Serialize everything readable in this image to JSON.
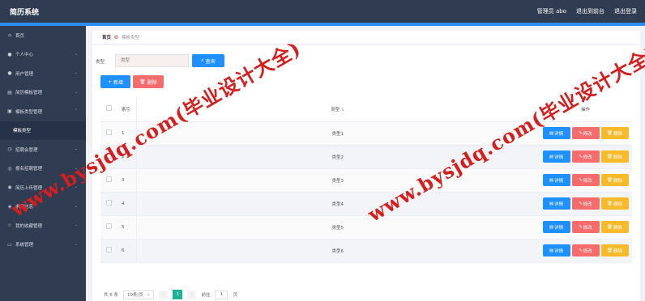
{
  "app": {
    "title": "简历系统"
  },
  "header": {
    "admin": "管理员 abo",
    "back_to_console": "退出到前台",
    "logout": "退出登录"
  },
  "sidebar": {
    "items": [
      {
        "label": "首页",
        "icon": "home-icon"
      },
      {
        "label": "个人中心",
        "icon": "user-icon"
      },
      {
        "label": "用户管理",
        "icon": "users-icon"
      },
      {
        "label": "简历模板管理",
        "icon": "template-icon"
      },
      {
        "label": "模板类型管理",
        "icon": "category-icon"
      },
      {
        "label": "模板类型",
        "icon": ""
      },
      {
        "label": "招聘会管理",
        "icon": "fair-icon"
      },
      {
        "label": "报名招聘管理",
        "icon": "signup-icon"
      },
      {
        "label": "简历上传管理",
        "icon": "upload-icon"
      },
      {
        "label": "求职信息",
        "icon": "job-icon"
      },
      {
        "label": "我的收藏管理",
        "icon": "favorite-icon"
      },
      {
        "label": "系统管理",
        "icon": "settings-icon"
      }
    ]
  },
  "breadcrumb": {
    "home": "首页",
    "current": "模板类型"
  },
  "search": {
    "label": "类型",
    "placeholder": "类型",
    "button": "查询"
  },
  "toolbar": {
    "add": "新增",
    "delete": "删除"
  },
  "table": {
    "headers": {
      "index": "索引",
      "type": "类型",
      "actions": "操作"
    },
    "rows": [
      {
        "index": "1",
        "type": "类型1"
      },
      {
        "index": "2",
        "type": "类型2"
      },
      {
        "index": "3",
        "type": "类型3"
      },
      {
        "index": "4",
        "type": "类型4"
      },
      {
        "index": "5",
        "type": "类型5"
      },
      {
        "index": "6",
        "type": "类型6"
      }
    ],
    "actions": {
      "detail": "详情",
      "edit": "修改",
      "delete": "删除"
    }
  },
  "pagination": {
    "total": "共 6 条",
    "page_size": "10条/页",
    "current_page": "1",
    "goto_label": "前往",
    "goto_value": "1",
    "page_suffix": "页"
  },
  "watermark": {
    "text": "www.bysjdq.com(毕业设计大全)"
  },
  "colors": {
    "topbar": "#2f3c52",
    "accent": "#1e90ff",
    "danger": "#f56c6c",
    "warning": "#f7ba2a",
    "pager_active": "#1ab394",
    "watermark": "#d71e1e"
  }
}
